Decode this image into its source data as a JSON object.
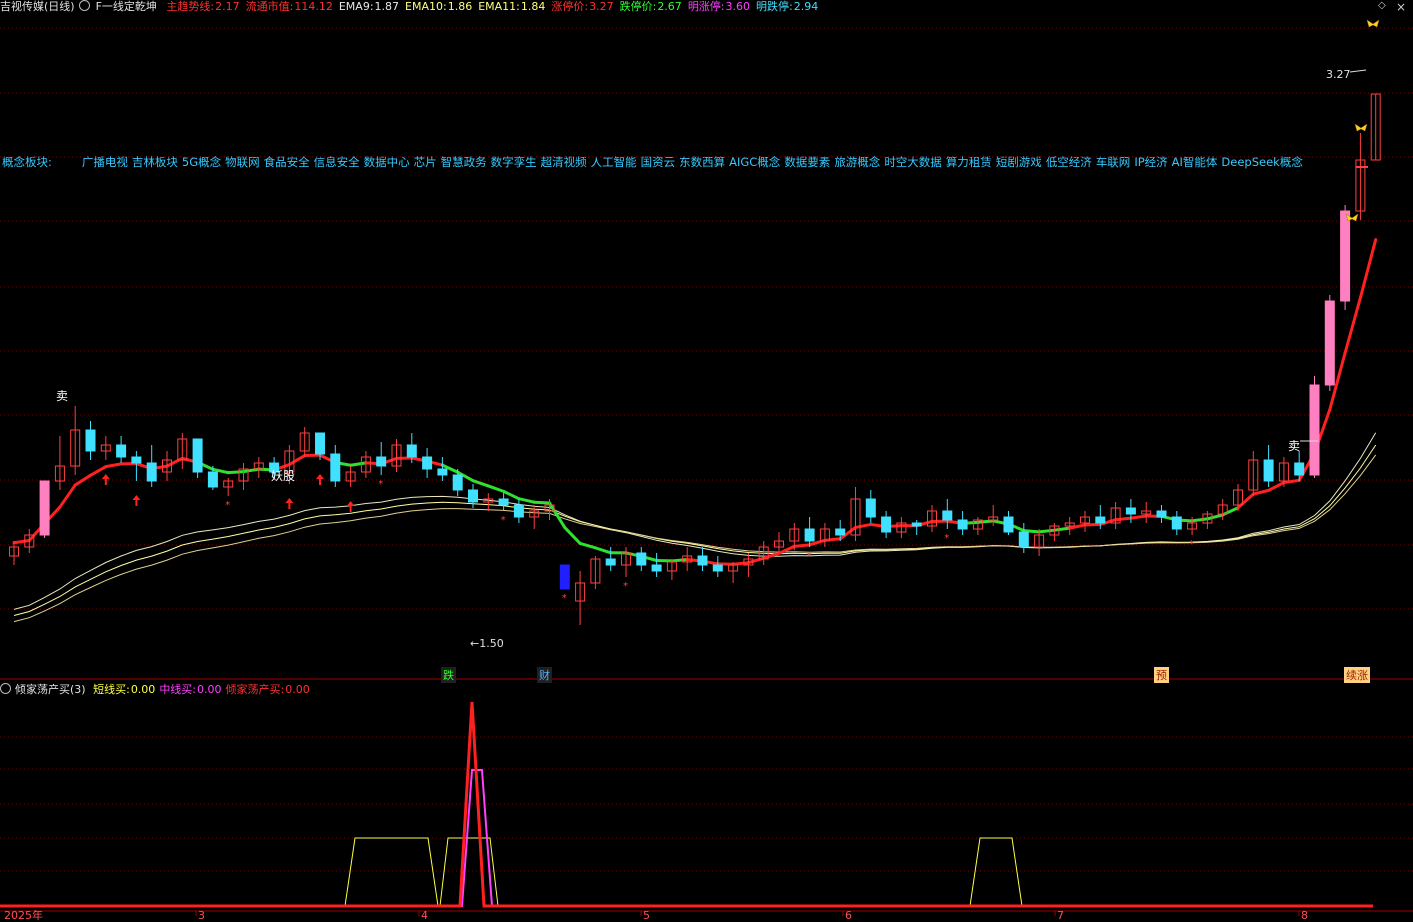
{
  "header": {
    "stock_name": "吉视传媒(日线)",
    "formula_name": "F一线定乾坤",
    "items": [
      {
        "label": "主趋势线:",
        "value": "2.17",
        "color": "#ff3030"
      },
      {
        "label": "流通市值:",
        "value": "114.12",
        "color": "#ff3030"
      },
      {
        "label": "EMA9:",
        "value": "1.87",
        "color": "#e8e8e8"
      },
      {
        "label": "EMA10:",
        "value": "1.86",
        "color": "#ffff80"
      },
      {
        "label": "EMA11:",
        "value": "1.84",
        "color": "#ffff80"
      },
      {
        "label": "涨停价:",
        "value": "3.27",
        "color": "#ff3030"
      },
      {
        "label": "跌停价:",
        "value": "2.67",
        "color": "#30ff30"
      },
      {
        "label": "明涨停:",
        "value": "3.60",
        "color": "#ff40ff"
      },
      {
        "label": "明跌停:",
        "value": "2.94",
        "color": "#40e0ff"
      }
    ]
  },
  "concepts": {
    "label": "概念板块:",
    "items": [
      "广播电视",
      "吉林板块",
      "5G概念",
      "物联网",
      "食品安全",
      "信息安全",
      "数据中心",
      "芯片",
      "智慧政务",
      "数字孪生",
      "超清视频",
      "人工智能",
      "国资云",
      "东数西算",
      "AIGC概念",
      "数据要素",
      "旅游概念",
      "时空大数据",
      "算力租赁",
      "短剧游戏",
      "低空经济",
      "车联网",
      "IP经济",
      "AI智能体",
      "DeepSeek概念"
    ]
  },
  "annotations": {
    "high_price": "3.27",
    "low_price": "1.50",
    "sell1": "卖",
    "sell2": "卖",
    "demon": "妖股",
    "event_die": "跌",
    "event_cai": "财",
    "event_yu": "预",
    "event_zhang": "续涨"
  },
  "indicator": {
    "title": "倾家荡产买(3)",
    "items": [
      {
        "label": "短线买:",
        "value": "0.00",
        "color": "#ffff40"
      },
      {
        "label": "中线买:",
        "value": "0.00",
        "color": "#ff40ff"
      },
      {
        "label": "倾家荡产买:",
        "value": "0.00",
        "color": "#ff3030"
      }
    ]
  },
  "time_axis": {
    "year_label": "2025年",
    "months": [
      "3",
      "4",
      "5",
      "6",
      "7",
      "8"
    ]
  },
  "controls": {
    "diamond": "◇",
    "close": "×"
  },
  "colors": {
    "up": "#ff4040",
    "down": "#40e0ff",
    "trend_red": "#ff2020",
    "trend_green": "#30e030",
    "ema": "#ffffa0",
    "limit_up": "#ff80c0",
    "grid": "#800000"
  },
  "chart_data": {
    "type": "candlestick",
    "price_range": [
      1.45,
      3.35
    ],
    "candles": [
      [
        1.73,
        1.78,
        1.7,
        1.76
      ],
      [
        1.76,
        1.82,
        1.74,
        1.8
      ],
      [
        1.8,
        1.98,
        1.79,
        1.98
      ],
      [
        1.98,
        2.13,
        1.95,
        2.03
      ],
      [
        2.03,
        2.23,
        2.0,
        2.15
      ],
      [
        2.15,
        2.18,
        2.05,
        2.08
      ],
      [
        2.08,
        2.13,
        2.05,
        2.1
      ],
      [
        2.1,
        2.13,
        2.04,
        2.06
      ],
      [
        2.06,
        2.08,
        1.98,
        2.04
      ],
      [
        2.04,
        2.1,
        1.96,
        1.98
      ],
      [
        2.01,
        2.08,
        1.98,
        2.05
      ],
      [
        2.05,
        2.14,
        2.02,
        2.12
      ],
      [
        2.12,
        2.12,
        1.99,
        2.01
      ],
      [
        2.01,
        2.03,
        1.95,
        1.96
      ],
      [
        1.96,
        1.99,
        1.93,
        1.98
      ],
      [
        1.98,
        2.04,
        1.95,
        2.02
      ],
      [
        2.02,
        2.06,
        1.99,
        2.04
      ],
      [
        2.04,
        2.06,
        1.99,
        2.01
      ],
      [
        2.01,
        2.1,
        1.97,
        2.08
      ],
      [
        2.08,
        2.16,
        2.06,
        2.14
      ],
      [
        2.14,
        2.14,
        2.05,
        2.07
      ],
      [
        2.07,
        2.1,
        1.96,
        1.98
      ],
      [
        1.98,
        2.03,
        1.96,
        2.01
      ],
      [
        2.01,
        2.08,
        1.99,
        2.06
      ],
      [
        2.06,
        2.11,
        2.0,
        2.03
      ],
      [
        2.03,
        2.12,
        2.01,
        2.1
      ],
      [
        2.1,
        2.14,
        2.04,
        2.06
      ],
      [
        2.06,
        2.09,
        1.99,
        2.02
      ],
      [
        2.02,
        2.06,
        1.98,
        2.0
      ],
      [
        2.0,
        2.02,
        1.93,
        1.95
      ],
      [
        1.95,
        1.97,
        1.89,
        1.91
      ],
      [
        1.91,
        1.94,
        1.88,
        1.92
      ],
      [
        1.92,
        1.94,
        1.88,
        1.9
      ],
      [
        1.9,
        1.92,
        1.84,
        1.86
      ],
      [
        1.86,
        1.9,
        1.82,
        1.88
      ],
      [
        1.88,
        1.92,
        1.85,
        1.9
      ],
      [
        1.7,
        1.7,
        1.62,
        1.62
      ],
      [
        1.58,
        1.68,
        1.5,
        1.64
      ],
      [
        1.64,
        1.73,
        1.62,
        1.72
      ],
      [
        1.72,
        1.76,
        1.68,
        1.7
      ],
      [
        1.7,
        1.76,
        1.66,
        1.74
      ],
      [
        1.74,
        1.76,
        1.68,
        1.7
      ],
      [
        1.7,
        1.74,
        1.66,
        1.68
      ],
      [
        1.68,
        1.72,
        1.65,
        1.71
      ],
      [
        1.71,
        1.76,
        1.68,
        1.73
      ],
      [
        1.73,
        1.76,
        1.68,
        1.7
      ],
      [
        1.7,
        1.73,
        1.66,
        1.68
      ],
      [
        1.68,
        1.71,
        1.64,
        1.7
      ],
      [
        1.7,
        1.74,
        1.66,
        1.72
      ],
      [
        1.72,
        1.78,
        1.7,
        1.76
      ],
      [
        1.76,
        1.81,
        1.74,
        1.78
      ],
      [
        1.78,
        1.84,
        1.75,
        1.82
      ],
      [
        1.82,
        1.86,
        1.76,
        1.78
      ],
      [
        1.78,
        1.84,
        1.76,
        1.82
      ],
      [
        1.82,
        1.85,
        1.78,
        1.8
      ],
      [
        1.8,
        1.96,
        1.78,
        1.92
      ],
      [
        1.92,
        1.95,
        1.84,
        1.86
      ],
      [
        1.86,
        1.88,
        1.79,
        1.81
      ],
      [
        1.81,
        1.86,
        1.79,
        1.84
      ],
      [
        1.84,
        1.85,
        1.8,
        1.83
      ],
      [
        1.83,
        1.9,
        1.81,
        1.88
      ],
      [
        1.88,
        1.92,
        1.82,
        1.85
      ],
      [
        1.85,
        1.88,
        1.8,
        1.82
      ],
      [
        1.82,
        1.86,
        1.8,
        1.85
      ],
      [
        1.85,
        1.9,
        1.83,
        1.86
      ],
      [
        1.86,
        1.88,
        1.8,
        1.81
      ],
      [
        1.81,
        1.84,
        1.74,
        1.76
      ],
      [
        1.76,
        1.82,
        1.73,
        1.8
      ],
      [
        1.8,
        1.84,
        1.78,
        1.83
      ],
      [
        1.83,
        1.86,
        1.8,
        1.84
      ],
      [
        1.84,
        1.88,
        1.81,
        1.86
      ],
      [
        1.86,
        1.9,
        1.82,
        1.84
      ],
      [
        1.84,
        1.91,
        1.82,
        1.89
      ],
      [
        1.89,
        1.92,
        1.84,
        1.87
      ],
      [
        1.87,
        1.91,
        1.84,
        1.88
      ],
      [
        1.88,
        1.9,
        1.84,
        1.86
      ],
      [
        1.86,
        1.88,
        1.8,
        1.82
      ],
      [
        1.82,
        1.86,
        1.8,
        1.84
      ],
      [
        1.84,
        1.88,
        1.82,
        1.87
      ],
      [
        1.87,
        1.92,
        1.85,
        1.9
      ],
      [
        1.9,
        1.97,
        1.88,
        1.95
      ],
      [
        1.95,
        2.08,
        1.93,
        2.05
      ],
      [
        2.05,
        2.1,
        1.96,
        1.98
      ],
      [
        1.98,
        2.06,
        1.96,
        2.04
      ],
      [
        2.04,
        2.08,
        1.98,
        2.0
      ],
      [
        2.0,
        2.33,
        1.99,
        2.3
      ],
      [
        2.3,
        2.6,
        2.28,
        2.58
      ],
      [
        2.58,
        2.9,
        2.55,
        2.88
      ],
      [
        2.88,
        3.14,
        2.85,
        3.05
      ],
      [
        3.05,
        3.27,
        3.05,
        3.27
      ]
    ]
  }
}
